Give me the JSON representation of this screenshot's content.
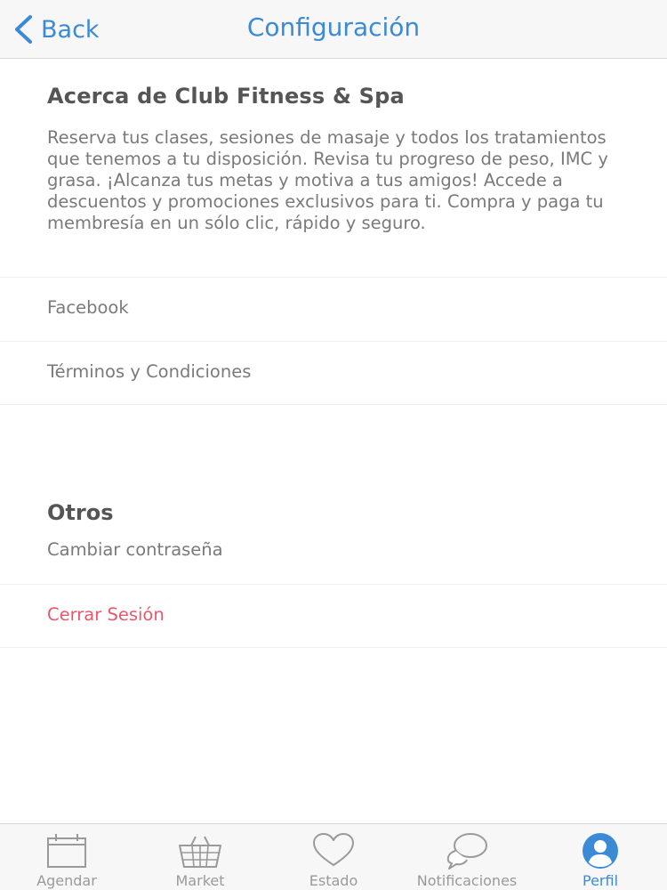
{
  "navbar": {
    "back_label": "Back",
    "title": "Configuración"
  },
  "about": {
    "title": "Acerca de Club Fitness & Spa",
    "text": "Reserva tus clases, sesiones de masaje y todos los tratamientos que tenemos a tu disposición. Revisa tu progreso de peso, IMC y grasa. ¡Alcanza tus metas y motiva a tus amigos! Accede a descuentos y promociones exclusivos para ti. Compra y paga tu membresía en un sólo clic, rápido y seguro."
  },
  "links": {
    "facebook": "Facebook",
    "terms": "Términos y Condiciones"
  },
  "others": {
    "title": "Otros",
    "change_password": "Cambiar contraseña",
    "logout": "Cerrar Sesión"
  },
  "tabs": [
    {
      "label": "Agendar",
      "icon": "calendar-icon"
    },
    {
      "label": "Market",
      "icon": "basket-icon"
    },
    {
      "label": "Estado",
      "icon": "heart-icon"
    },
    {
      "label": "Notificaciones",
      "icon": "chat-bubbles-icon"
    },
    {
      "label": "Perfil",
      "icon": "profile-icon",
      "active": true
    }
  ],
  "colors": {
    "accent": "#3b8ad6",
    "danger": "#e8586b",
    "inactive": "#9a9a9a"
  }
}
